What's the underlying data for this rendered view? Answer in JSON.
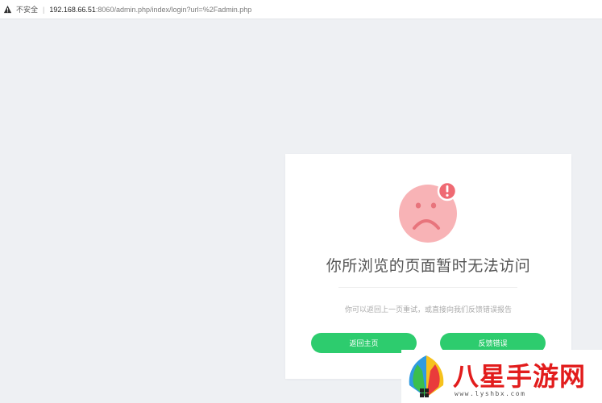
{
  "address_bar": {
    "security_label": "不安全",
    "url_host": "192.168.66.51",
    "url_rest": ":8060/admin.php/index/login?url=%2Fadmin.php"
  },
  "error_card": {
    "headline": "你所浏览的页面暂时无法访问",
    "subtext": "你可以返回上一页重试，或直接向我们反馈错误报告",
    "home_button": "返回主页",
    "feedback_button": "反馈错误",
    "face_icon": "sad-face-icon",
    "alert_icon": "exclamation-icon"
  },
  "watermark": {
    "title": "八星手游网",
    "subtitle": "www.lyshbx.com"
  },
  "colors": {
    "accent": "#2dcc6e",
    "face": "#f8b3b6",
    "alert": "#ef6a73",
    "watermark": "#e21c1c"
  }
}
